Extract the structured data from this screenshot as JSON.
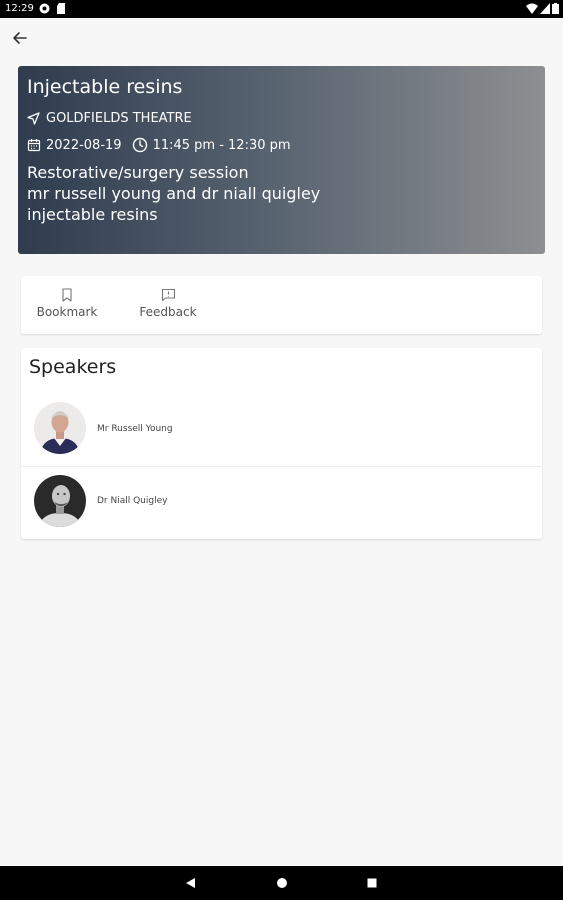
{
  "status_bar": {
    "time": "12:29"
  },
  "event": {
    "title": "Injectable resins",
    "venue": "GOLDFIELDS THEATRE",
    "date": "2022-08-19",
    "time_range": "11:45 pm - 12:30 pm",
    "description": "Restorative/surgery session\nmr russell young and dr niall quigley\ninjectable resins"
  },
  "actions": {
    "bookmark_label": "Bookmark",
    "feedback_label": "Feedback"
  },
  "speakers": {
    "heading": "Speakers",
    "items": [
      {
        "name": "Mr Russell Young"
      },
      {
        "name": "Dr Niall Quigley"
      }
    ]
  },
  "icons": {
    "back": "arrow-left-icon",
    "venue": "navigation-arrow-icon",
    "date": "calendar-icon",
    "time": "clock-icon",
    "bookmark": "bookmark-icon",
    "feedback": "feedback-icon"
  }
}
